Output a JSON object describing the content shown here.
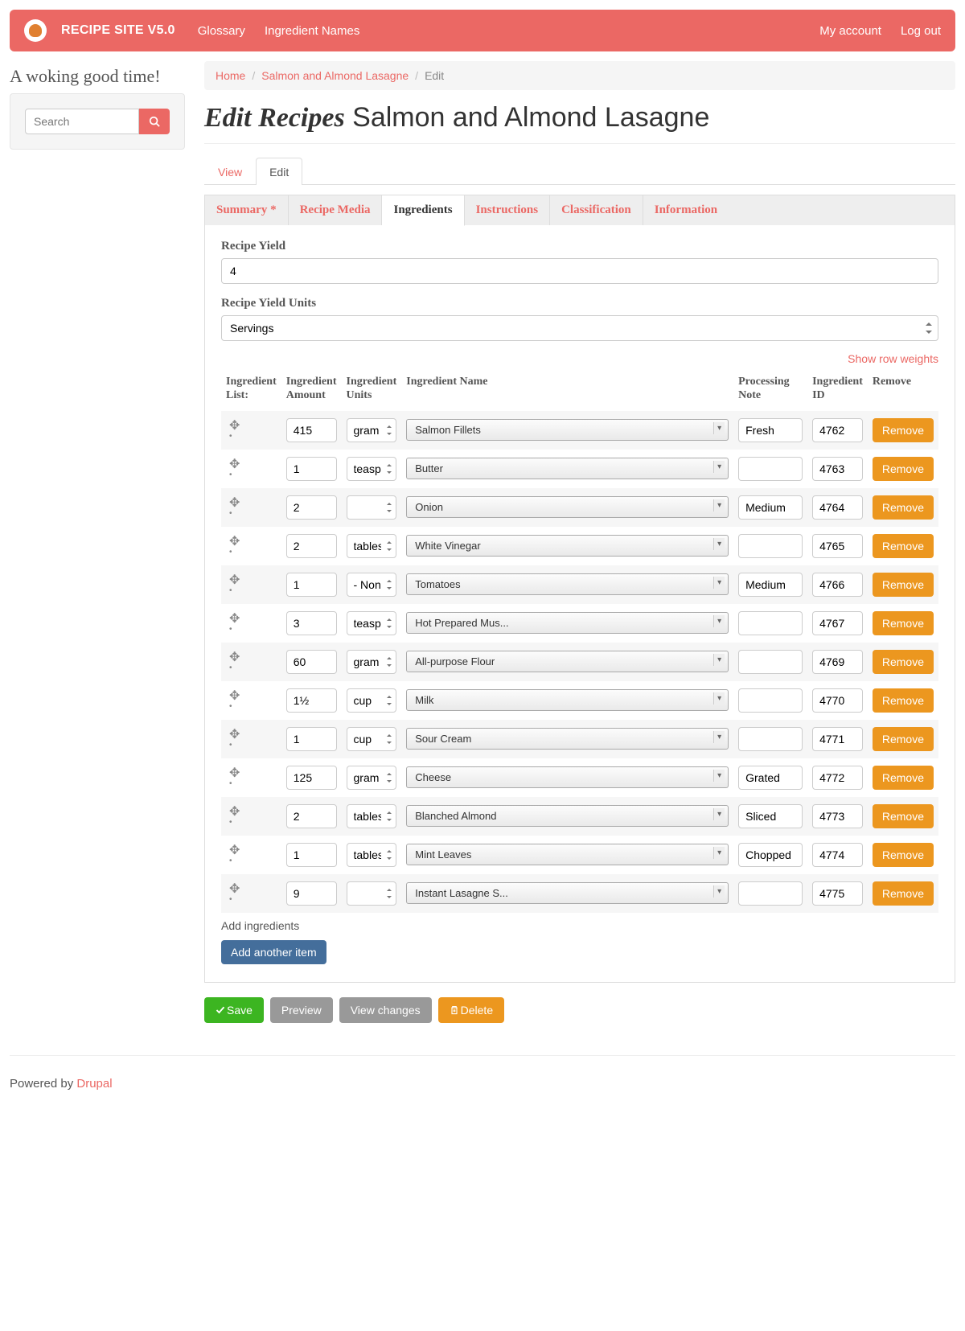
{
  "nav": {
    "brand": "RECIPE SITE V5.0",
    "links": [
      "Glossary",
      "Ingredient Names"
    ],
    "right": [
      "My account",
      "Log out"
    ]
  },
  "tagline": "A woking good time!",
  "search": {
    "placeholder": "Search"
  },
  "breadcrumb": {
    "home": "Home",
    "parent": "Salmon and Almond Lasagne",
    "current": "Edit"
  },
  "title": {
    "prefix": "Edit Recipes",
    "name": "Salmon and Almond Lasagne"
  },
  "tabs_primary": [
    "View",
    "Edit"
  ],
  "tabs_primary_active": 1,
  "tabs_secondary": [
    "Summary *",
    "Recipe Media",
    "Ingredients",
    "Instructions",
    "Classification",
    "Information"
  ],
  "tabs_secondary_active": 2,
  "labels": {
    "yield": "Recipe Yield",
    "yield_units": "Recipe Yield Units",
    "show_weights": "Show row weights",
    "add_ing": "Add ingredients",
    "add_another": "Add another item"
  },
  "yield": {
    "value": "4",
    "units": "Servings"
  },
  "columns": {
    "list": "Ingredient List:",
    "amount": "Ingredient Amount",
    "units": "Ingredient Units",
    "name": "Ingredient Name",
    "note": "Processing Note",
    "id": "Ingredient ID",
    "remove": "Remove"
  },
  "remove_label": "Remove",
  "ingredients": [
    {
      "amount": "415",
      "units": "gram",
      "name": "Salmon Fillets",
      "note": "Fresh",
      "id": "4762"
    },
    {
      "amount": "1",
      "units": "teaspoo",
      "name": "Butter",
      "note": "",
      "id": "4763"
    },
    {
      "amount": "2",
      "units": "",
      "name": "Onion",
      "note": "Medium",
      "id": "4764"
    },
    {
      "amount": "2",
      "units": "tablesp",
      "name": "White Vinegar",
      "note": "",
      "id": "4765"
    },
    {
      "amount": "1",
      "units": "- None -",
      "name": "Tomatoes",
      "note": "Medium",
      "id": "4766"
    },
    {
      "amount": "3",
      "units": "teaspoo",
      "name": "Hot Prepared Mus...",
      "note": "",
      "id": "4767"
    },
    {
      "amount": "60",
      "units": "gram",
      "name": "All-purpose Flour",
      "note": "",
      "id": "4769"
    },
    {
      "amount": "1½",
      "units": "cup",
      "name": "Milk",
      "note": "",
      "id": "4770"
    },
    {
      "amount": "1",
      "units": "cup",
      "name": "Sour Cream",
      "note": "",
      "id": "4771"
    },
    {
      "amount": "125",
      "units": "gram",
      "name": "Cheese",
      "note": "Grated",
      "id": "4772"
    },
    {
      "amount": "2",
      "units": "tablesp",
      "name": "Blanched Almond",
      "note": "Sliced",
      "id": "4773"
    },
    {
      "amount": "1",
      "units": "tablesp",
      "name": "Mint Leaves",
      "note": "Chopped",
      "id": "4774"
    },
    {
      "amount": "9",
      "units": "",
      "name": "Instant Lasagne S...",
      "note": "",
      "id": "4775"
    }
  ],
  "actions": {
    "save": "Save",
    "preview": "Preview",
    "view_changes": "View changes",
    "delete": "Delete"
  },
  "footer": {
    "prefix": "Powered by ",
    "link": "Drupal"
  }
}
